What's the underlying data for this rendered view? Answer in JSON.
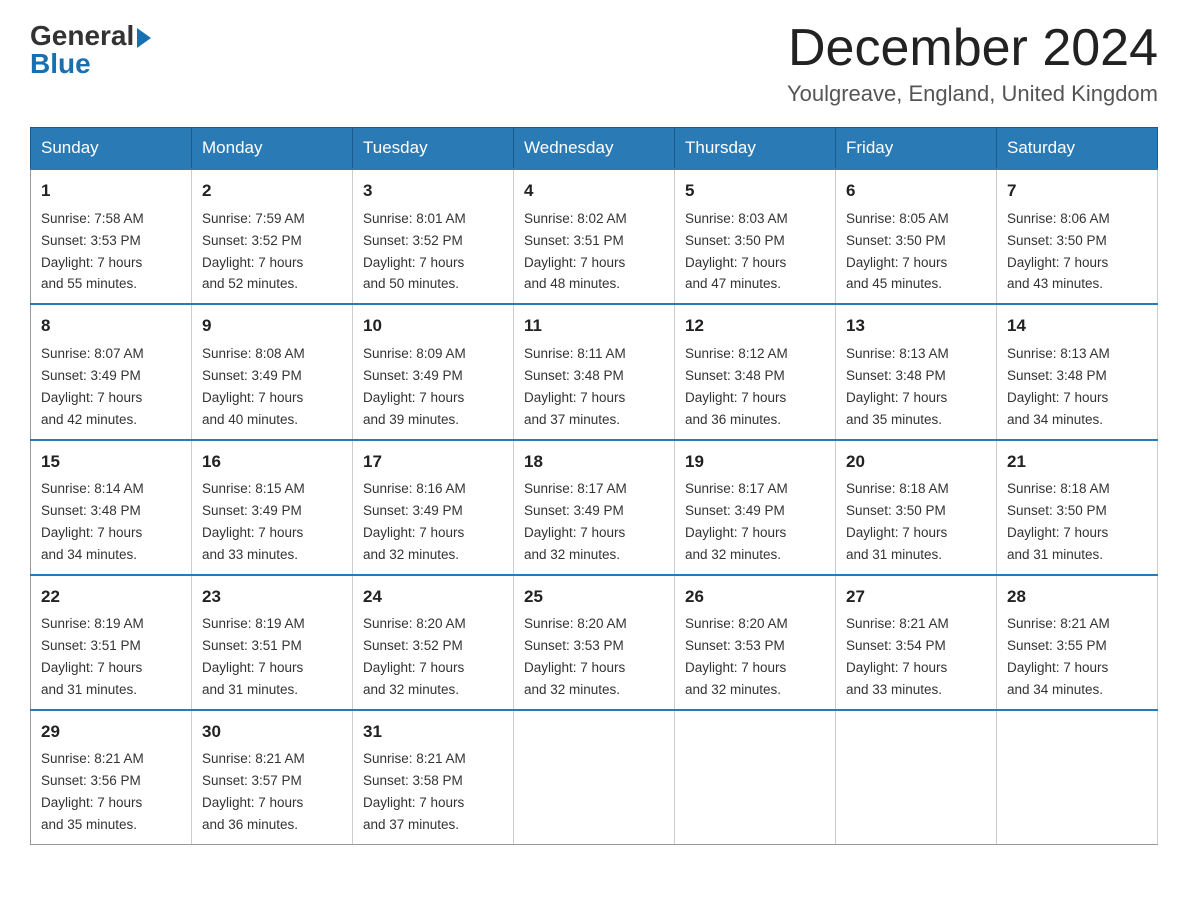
{
  "header": {
    "logo": {
      "general": "General",
      "blue": "Blue"
    },
    "title": "December 2024",
    "location": "Youlgreave, England, United Kingdom"
  },
  "days_of_week": [
    "Sunday",
    "Monday",
    "Tuesday",
    "Wednesday",
    "Thursday",
    "Friday",
    "Saturday"
  ],
  "weeks": [
    [
      {
        "day": "1",
        "sunrise": "7:58 AM",
        "sunset": "3:53 PM",
        "daylight": "7 hours and 55 minutes."
      },
      {
        "day": "2",
        "sunrise": "7:59 AM",
        "sunset": "3:52 PM",
        "daylight": "7 hours and 52 minutes."
      },
      {
        "day": "3",
        "sunrise": "8:01 AM",
        "sunset": "3:52 PM",
        "daylight": "7 hours and 50 minutes."
      },
      {
        "day": "4",
        "sunrise": "8:02 AM",
        "sunset": "3:51 PM",
        "daylight": "7 hours and 48 minutes."
      },
      {
        "day": "5",
        "sunrise": "8:03 AM",
        "sunset": "3:50 PM",
        "daylight": "7 hours and 47 minutes."
      },
      {
        "day": "6",
        "sunrise": "8:05 AM",
        "sunset": "3:50 PM",
        "daylight": "7 hours and 45 minutes."
      },
      {
        "day": "7",
        "sunrise": "8:06 AM",
        "sunset": "3:50 PM",
        "daylight": "7 hours and 43 minutes."
      }
    ],
    [
      {
        "day": "8",
        "sunrise": "8:07 AM",
        "sunset": "3:49 PM",
        "daylight": "7 hours and 42 minutes."
      },
      {
        "day": "9",
        "sunrise": "8:08 AM",
        "sunset": "3:49 PM",
        "daylight": "7 hours and 40 minutes."
      },
      {
        "day": "10",
        "sunrise": "8:09 AM",
        "sunset": "3:49 PM",
        "daylight": "7 hours and 39 minutes."
      },
      {
        "day": "11",
        "sunrise": "8:11 AM",
        "sunset": "3:48 PM",
        "daylight": "7 hours and 37 minutes."
      },
      {
        "day": "12",
        "sunrise": "8:12 AM",
        "sunset": "3:48 PM",
        "daylight": "7 hours and 36 minutes."
      },
      {
        "day": "13",
        "sunrise": "8:13 AM",
        "sunset": "3:48 PM",
        "daylight": "7 hours and 35 minutes."
      },
      {
        "day": "14",
        "sunrise": "8:13 AM",
        "sunset": "3:48 PM",
        "daylight": "7 hours and 34 minutes."
      }
    ],
    [
      {
        "day": "15",
        "sunrise": "8:14 AM",
        "sunset": "3:48 PM",
        "daylight": "7 hours and 34 minutes."
      },
      {
        "day": "16",
        "sunrise": "8:15 AM",
        "sunset": "3:49 PM",
        "daylight": "7 hours and 33 minutes."
      },
      {
        "day": "17",
        "sunrise": "8:16 AM",
        "sunset": "3:49 PM",
        "daylight": "7 hours and 32 minutes."
      },
      {
        "day": "18",
        "sunrise": "8:17 AM",
        "sunset": "3:49 PM",
        "daylight": "7 hours and 32 minutes."
      },
      {
        "day": "19",
        "sunrise": "8:17 AM",
        "sunset": "3:49 PM",
        "daylight": "7 hours and 32 minutes."
      },
      {
        "day": "20",
        "sunrise": "8:18 AM",
        "sunset": "3:50 PM",
        "daylight": "7 hours and 31 minutes."
      },
      {
        "day": "21",
        "sunrise": "8:18 AM",
        "sunset": "3:50 PM",
        "daylight": "7 hours and 31 minutes."
      }
    ],
    [
      {
        "day": "22",
        "sunrise": "8:19 AM",
        "sunset": "3:51 PM",
        "daylight": "7 hours and 31 minutes."
      },
      {
        "day": "23",
        "sunrise": "8:19 AM",
        "sunset": "3:51 PM",
        "daylight": "7 hours and 31 minutes."
      },
      {
        "day": "24",
        "sunrise": "8:20 AM",
        "sunset": "3:52 PM",
        "daylight": "7 hours and 32 minutes."
      },
      {
        "day": "25",
        "sunrise": "8:20 AM",
        "sunset": "3:53 PM",
        "daylight": "7 hours and 32 minutes."
      },
      {
        "day": "26",
        "sunrise": "8:20 AM",
        "sunset": "3:53 PM",
        "daylight": "7 hours and 32 minutes."
      },
      {
        "day": "27",
        "sunrise": "8:21 AM",
        "sunset": "3:54 PM",
        "daylight": "7 hours and 33 minutes."
      },
      {
        "day": "28",
        "sunrise": "8:21 AM",
        "sunset": "3:55 PM",
        "daylight": "7 hours and 34 minutes."
      }
    ],
    [
      {
        "day": "29",
        "sunrise": "8:21 AM",
        "sunset": "3:56 PM",
        "daylight": "7 hours and 35 minutes."
      },
      {
        "day": "30",
        "sunrise": "8:21 AM",
        "sunset": "3:57 PM",
        "daylight": "7 hours and 36 minutes."
      },
      {
        "day": "31",
        "sunrise": "8:21 AM",
        "sunset": "3:58 PM",
        "daylight": "7 hours and 37 minutes."
      },
      null,
      null,
      null,
      null
    ]
  ],
  "labels": {
    "sunrise": "Sunrise:",
    "sunset": "Sunset:",
    "daylight": "Daylight:"
  }
}
